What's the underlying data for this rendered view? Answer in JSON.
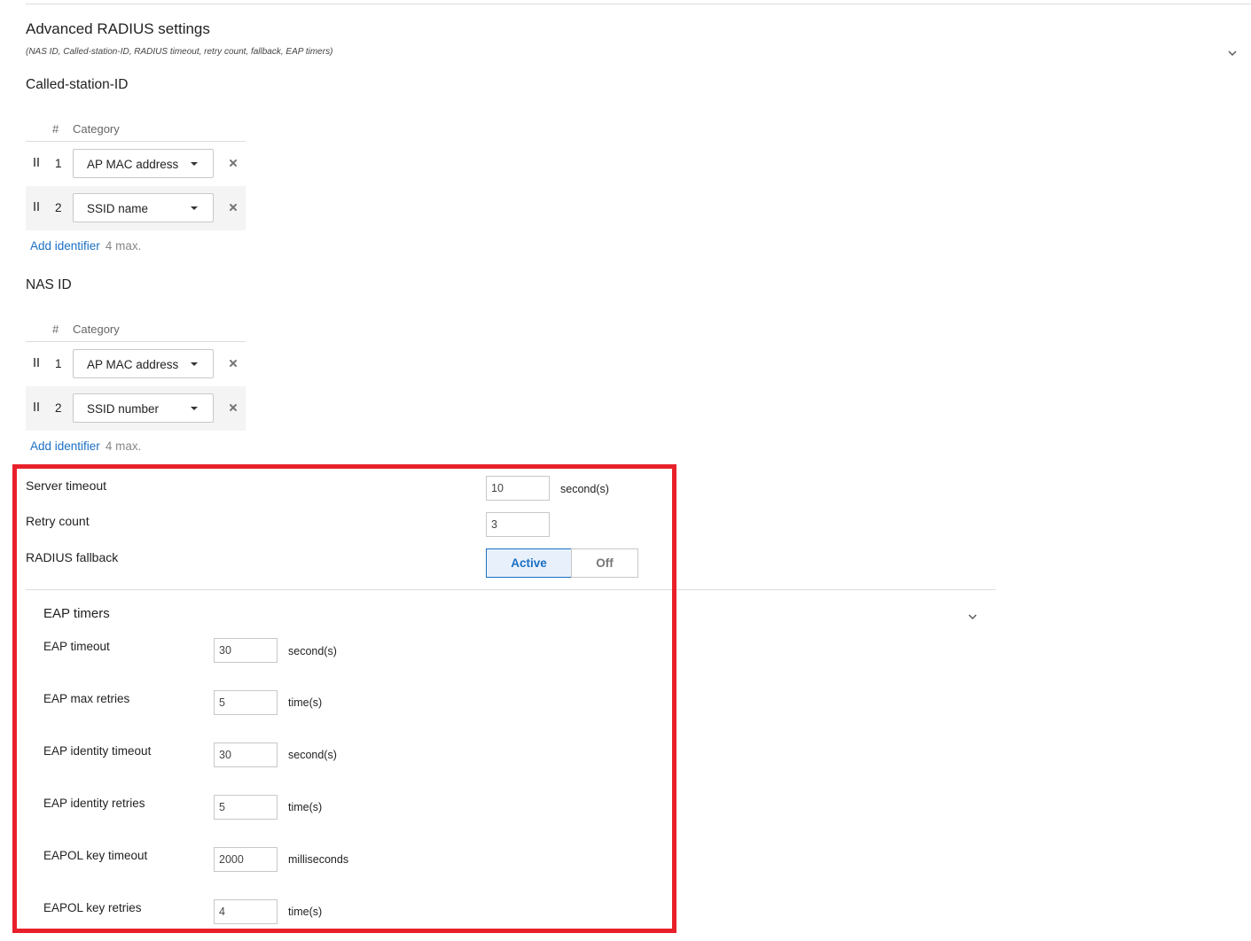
{
  "header": {
    "title": "Advanced RADIUS settings",
    "subtitle": "(NAS ID, Called-station-ID, RADIUS timeout, retry count, fallback, EAP timers)"
  },
  "called_station": {
    "title": "Called-station-ID",
    "col_hash": "#",
    "col_category": "Category",
    "rows": [
      {
        "num": "1",
        "value": "AP MAC address"
      },
      {
        "num": "2",
        "value": "SSID name"
      }
    ],
    "add_label": "Add identifier",
    "max_note": "4 max."
  },
  "nas_id": {
    "title": "NAS ID",
    "col_hash": "#",
    "col_category": "Category",
    "rows": [
      {
        "num": "1",
        "value": "AP MAC address"
      },
      {
        "num": "2",
        "value": "SSID number"
      }
    ],
    "add_label": "Add identifier",
    "max_note": "4 max."
  },
  "server": {
    "timeout_label": "Server timeout",
    "timeout_value": "10",
    "timeout_unit": "second(s)",
    "retry_label": "Retry count",
    "retry_value": "3",
    "fallback_label": "RADIUS fallback",
    "fallback_active": "Active",
    "fallback_off": "Off",
    "fallback_selected": "Active"
  },
  "eap": {
    "title": "EAP timers",
    "fields": [
      {
        "label": "EAP timeout",
        "value": "30",
        "unit": "second(s)"
      },
      {
        "label": "EAP max retries",
        "value": "5",
        "unit": "time(s)"
      },
      {
        "label": "EAP identity timeout",
        "value": "30",
        "unit": "second(s)"
      },
      {
        "label": "EAP identity retries",
        "value": "5",
        "unit": "time(s)"
      },
      {
        "label": "EAPOL key timeout",
        "value": "2000",
        "unit": "milliseconds"
      },
      {
        "label": "EAPOL key retries",
        "value": "4",
        "unit": "time(s)"
      }
    ]
  },
  "colors": {
    "accent": "#1a6fc4",
    "highlight_box": "#e8202a",
    "row_shade": "#f4f4f4"
  },
  "icons": {
    "collapse": "chevron-down-icon",
    "drag": "drag-handle-icon",
    "remove": "close-icon",
    "dropdown": "caret-down-icon"
  }
}
